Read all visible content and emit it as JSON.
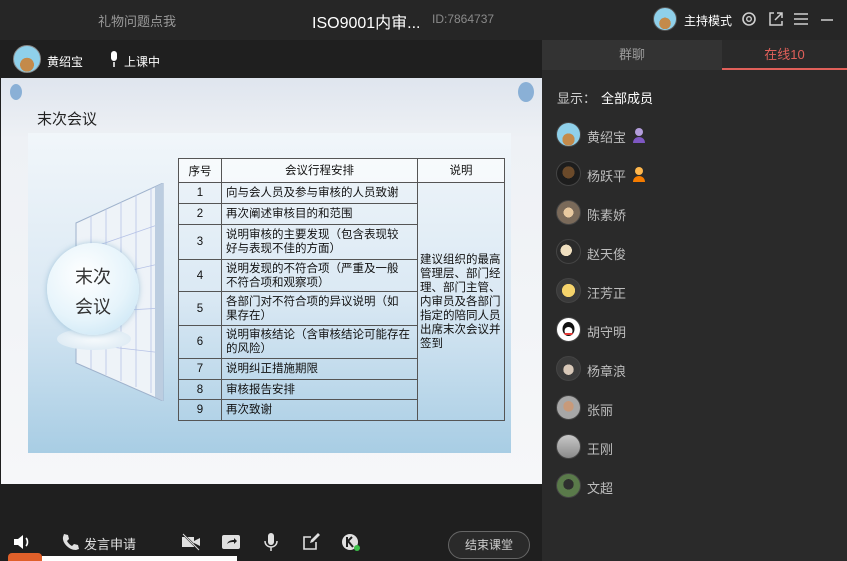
{
  "titlebar": {
    "gift_label": "礼物问题点我",
    "room_title": "ISO9001内审...",
    "room_id": "ID:7864737",
    "host_mode_label": "主持模式"
  },
  "stage": {
    "teacher_name": "黄绍宝",
    "status": "上课中"
  },
  "slide": {
    "title": "末次会议",
    "circle_text_line1": "末次",
    "circle_text_line2": "会议",
    "table": {
      "headers": [
        "序号",
        "会议行程安排",
        "说明"
      ],
      "rows": [
        {
          "no": "1",
          "item": "向与会人员及参与审核的人员致谢"
        },
        {
          "no": "2",
          "item": "再次阐述审核目的和范围"
        },
        {
          "no": "3",
          "item": "说明审核的主要发现（包含表现较 好与表现不佳的方面）"
        },
        {
          "no": "4",
          "item": "说明发现的不符合项（严重及一般 不符合项和观察项）"
        },
        {
          "no": "5",
          "item": "各部门对不符合项的异议说明（如 果存在）"
        },
        {
          "no": "6",
          "item": "说明审核结论（含审核结论可能存在的风险）"
        },
        {
          "no": "7",
          "item": "说明纠正措施期限"
        },
        {
          "no": "8",
          "item": "审核报告安排"
        },
        {
          "no": "9",
          "item": "再次致谢"
        }
      ],
      "note": "建议组织的最高管理层、部门经理、部门主管、内审员及各部门指定的陪同人员出席末次会议并签到"
    }
  },
  "bottombar": {
    "request_label": "发言申请",
    "end_label": "结束课堂"
  },
  "side": {
    "tab_chat": "群聊",
    "tab_online": "在线10",
    "filter_label": "显示：",
    "filter_value": "全部成员",
    "members": [
      {
        "name": "黄绍宝"
      },
      {
        "name": "杨跃平"
      },
      {
        "name": "陈素娇"
      },
      {
        "name": "赵天俊"
      },
      {
        "name": "汪芳正"
      },
      {
        "name": "胡守明"
      },
      {
        "name": "杨章浪"
      },
      {
        "name": "张丽"
      },
      {
        "name": "王刚"
      },
      {
        "name": "文超"
      }
    ]
  },
  "colors": {
    "accent": "#e0605a",
    "background": "#1f1f1f",
    "panel": "#2a2a2a"
  }
}
